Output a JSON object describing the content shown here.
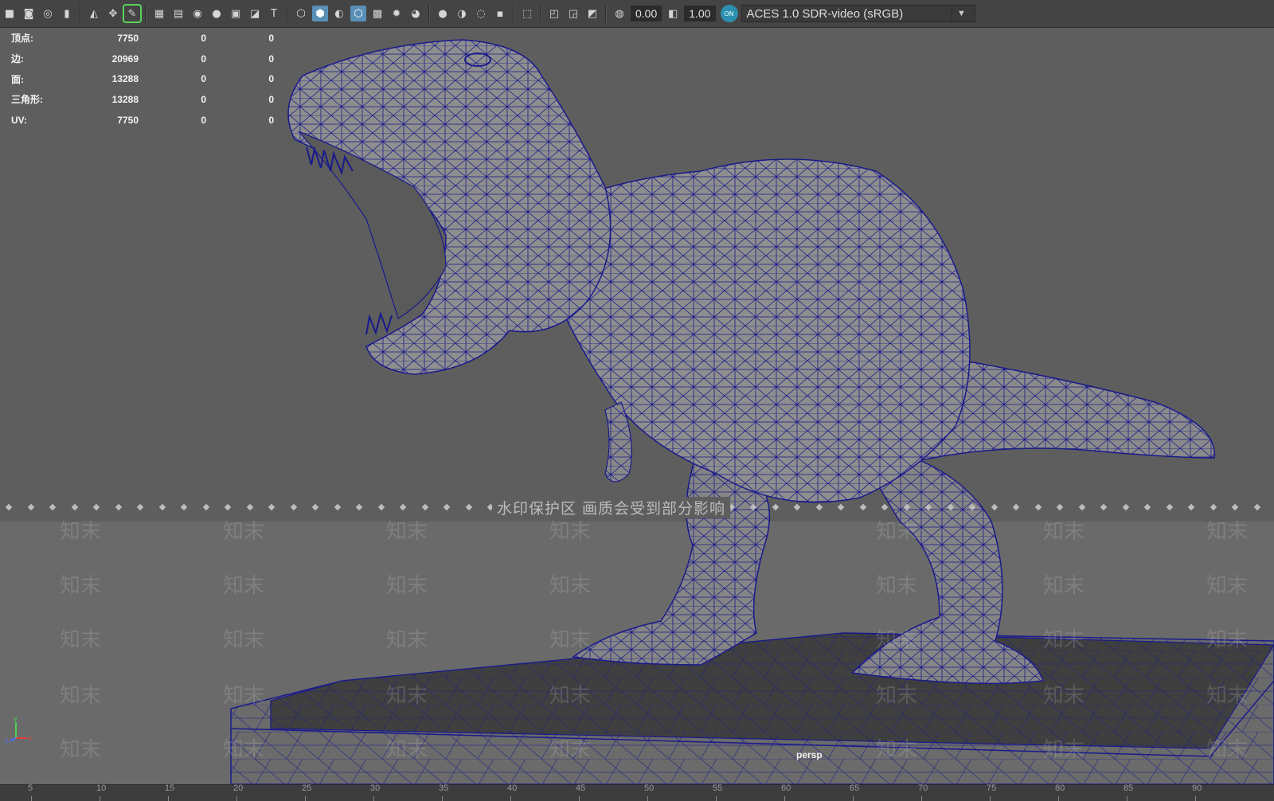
{
  "toolbar": {
    "icons": [
      "camera-icon",
      "camera-attr-icon",
      "bookmark-camera-icon",
      "bookmark-icon",
      "image-plane-icon",
      "2d-pan-zoom-icon",
      "grease-pencil-icon",
      "grid-icon",
      "film-gate-icon",
      "resolution-gate-icon",
      "gate-mask-icon",
      "field-chart-icon",
      "safe-action-icon",
      "safe-title-icon",
      "wireframe-icon",
      "smooth-shade-icon",
      "default-material-icon",
      "wireframe-on-shaded-icon",
      "textured-icon",
      "use-all-lights-icon",
      "shadows-icon",
      "screen-space-ao-icon",
      "motion-blur-icon",
      "anti-aliasing-icon",
      "depth-of-field-icon",
      "isolate-select-icon",
      "xray-icon",
      "xray-active-components-icon",
      "xray-joints-icon",
      "exposure-icon",
      "gamma-icon",
      "color-management-icon"
    ],
    "exposure_value": "0.00",
    "gamma_value": "1.00",
    "color_management_badge": "ON",
    "color_space": "ACES 1.0 SDR-video (sRGB)"
  },
  "hud": {
    "rows": [
      {
        "label": "顶点:",
        "value": "7750",
        "c1": "0",
        "c2": "0"
      },
      {
        "label": "边:",
        "value": "20969",
        "c1": "0",
        "c2": "0"
      },
      {
        "label": "面:",
        "value": "13288",
        "c1": "0",
        "c2": "0"
      },
      {
        "label": "三角形:",
        "value": "13288",
        "c1": "0",
        "c2": "0"
      },
      {
        "label": "UV:",
        "value": "7750",
        "c1": "0",
        "c2": "0"
      }
    ]
  },
  "watermark": {
    "center_text": "水印保护区  画质会受到部分影响",
    "mark_text": "知末"
  },
  "viewport": {
    "camera_label": "persp",
    "axis_labels": {
      "x": "x",
      "y": "y",
      "z": "z"
    }
  },
  "timeline": {
    "ticks": [
      "5",
      "10",
      "15",
      "20",
      "25",
      "30",
      "35",
      "40",
      "45",
      "50",
      "55",
      "60",
      "65",
      "70",
      "75",
      "80",
      "85",
      "90"
    ]
  },
  "colors": {
    "toolbar_bg": "#444444",
    "viewport_bg": "#5e5e5e",
    "wire": "#1a1a8c",
    "active_button": "#5a8fb8"
  }
}
